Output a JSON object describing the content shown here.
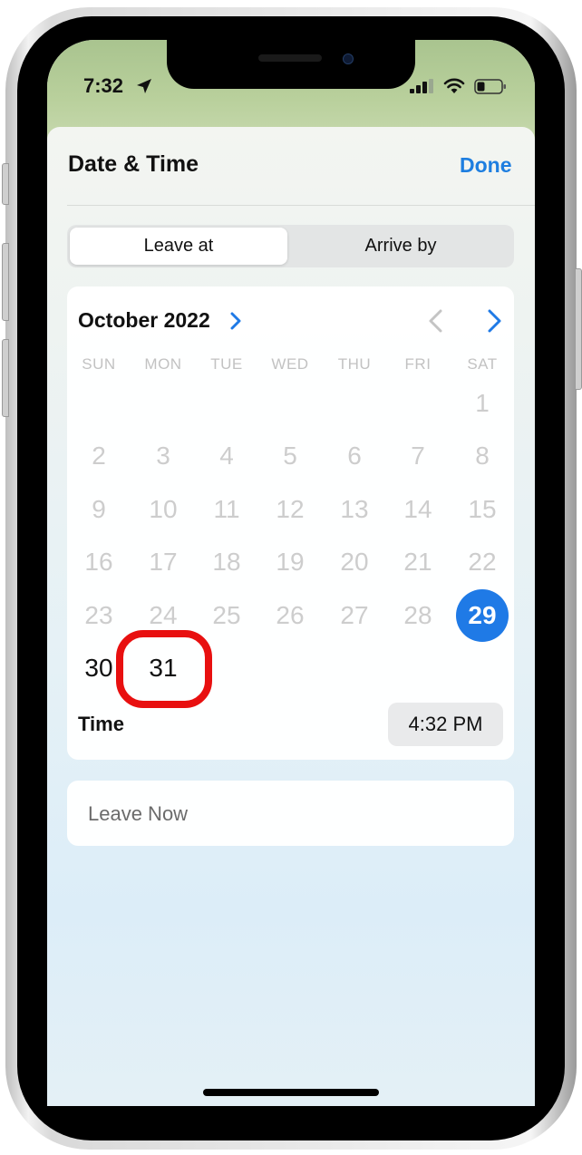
{
  "status_bar": {
    "time": "7:32",
    "icons": [
      "location-arrow-icon",
      "cellular-signal-icon",
      "wifi-icon",
      "battery-icon"
    ]
  },
  "sheet": {
    "title": "Date & Time",
    "done_label": "Done",
    "segmented": {
      "options": [
        "Leave at",
        "Arrive by"
      ],
      "selected": "Leave at"
    }
  },
  "calendar": {
    "month_label": "October 2022",
    "weekdays": [
      "SUN",
      "MON",
      "TUE",
      "WED",
      "THU",
      "FRI",
      "SAT"
    ],
    "weeks": [
      [
        "",
        "",
        "",
        "",
        "",
        "",
        "1"
      ],
      [
        "2",
        "3",
        "4",
        "5",
        "6",
        "7",
        "8"
      ],
      [
        "9",
        "10",
        "11",
        "12",
        "13",
        "14",
        "15"
      ],
      [
        "16",
        "17",
        "18",
        "19",
        "20",
        "21",
        "22"
      ],
      [
        "23",
        "24",
        "25",
        "26",
        "27",
        "28",
        "29"
      ],
      [
        "30",
        "31",
        "",
        "",
        "",
        "",
        ""
      ]
    ],
    "selected_day": "29",
    "enabled_days": [
      "29",
      "30",
      "31"
    ],
    "highlighted_day": "31",
    "accent_color": "#1f7ae6",
    "highlight_color": "#e81010"
  },
  "time": {
    "label": "Time",
    "value": "4:32 PM"
  },
  "leave_now": {
    "label": "Leave Now"
  }
}
